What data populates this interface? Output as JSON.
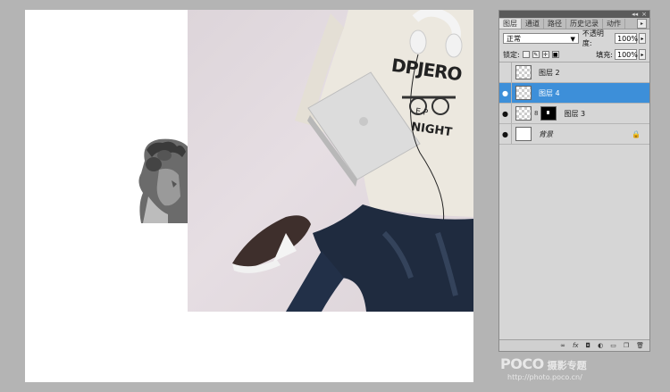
{
  "panel": {
    "tabs": [
      "图层",
      "通道",
      "路径",
      "历史记录",
      "动作"
    ],
    "active_tab": 0,
    "blend_mode": "正常",
    "opacity_label": "不透明度:",
    "opacity_value": "100%",
    "lock_label": "锁定:",
    "fill_label": "填充:",
    "fill_value": "100%",
    "layers": [
      {
        "name": "图层 2",
        "visible": false,
        "selected": false
      },
      {
        "name": "图层 4",
        "visible": true,
        "selected": true
      },
      {
        "name": "图层 3",
        "visible": true,
        "selected": false
      },
      {
        "name": "背景",
        "visible": true,
        "selected": false
      }
    ],
    "accent_color": "#3d8fd9"
  },
  "shirt_text": {
    "line1": "DPJERO",
    "line2": "E  P",
    "line3": "NIGHT"
  },
  "watermark": {
    "logo": "POCO",
    "subtitle": "摄影专题",
    "url": "http://photo.poco.cn/"
  }
}
